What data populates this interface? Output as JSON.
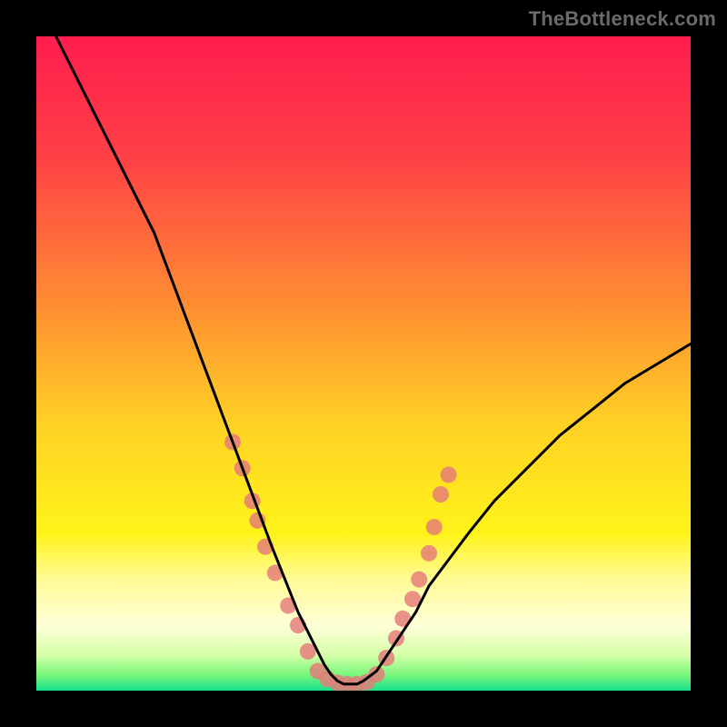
{
  "watermark": "TheBottleneck.com",
  "chart_data": {
    "type": "line",
    "title": "",
    "xlabel": "",
    "ylabel": "",
    "xlim": [
      0,
      100
    ],
    "ylim": [
      0,
      100
    ],
    "gradient_stops": [
      {
        "offset": 0.0,
        "color": "#ff1d4e"
      },
      {
        "offset": 0.18,
        "color": "#ff3f46"
      },
      {
        "offset": 0.4,
        "color": "#ff8a33"
      },
      {
        "offset": 0.6,
        "color": "#ffd324"
      },
      {
        "offset": 0.76,
        "color": "#fff31a"
      },
      {
        "offset": 0.83,
        "color": "#fffb96"
      },
      {
        "offset": 0.9,
        "color": "#ffffd8"
      },
      {
        "offset": 0.945,
        "color": "#d6ffa8"
      },
      {
        "offset": 0.975,
        "color": "#7cf87d"
      },
      {
        "offset": 1.0,
        "color": "#18e08b"
      }
    ],
    "series": [
      {
        "name": "bottleneck-curve",
        "color": "#000000",
        "stroke_width": 3,
        "x": [
          3,
          6,
          9,
          12,
          15,
          18,
          21,
          24,
          27,
          30,
          33,
          36,
          38,
          40,
          42,
          43,
          44,
          45,
          46,
          47,
          48,
          49,
          50,
          52,
          54,
          56,
          58,
          60,
          63,
          66,
          70,
          75,
          80,
          85,
          90,
          95,
          100
        ],
        "y": [
          100,
          94,
          88,
          82,
          76,
          70,
          62,
          54,
          46,
          38,
          30,
          22,
          17,
          12,
          8,
          6,
          4,
          2.5,
          1.5,
          1,
          1,
          1,
          1.5,
          3,
          6,
          9,
          12,
          16,
          20,
          24,
          29,
          34,
          39,
          43,
          47,
          50,
          53
        ]
      }
    ],
    "markers": {
      "name": "highlight-dots",
      "color": "#e47a7a",
      "opacity": 0.82,
      "radius": 9,
      "points": [
        {
          "x": 30.0,
          "y": 38
        },
        {
          "x": 31.5,
          "y": 34
        },
        {
          "x": 33.0,
          "y": 29
        },
        {
          "x": 33.8,
          "y": 26
        },
        {
          "x": 35.0,
          "y": 22
        },
        {
          "x": 36.5,
          "y": 18
        },
        {
          "x": 38.5,
          "y": 13
        },
        {
          "x": 40.0,
          "y": 10
        },
        {
          "x": 41.5,
          "y": 6
        },
        {
          "x": 43.0,
          "y": 3
        },
        {
          "x": 44.5,
          "y": 1.8
        },
        {
          "x": 46.0,
          "y": 1.2
        },
        {
          "x": 47.5,
          "y": 1
        },
        {
          "x": 49.0,
          "y": 1
        },
        {
          "x": 50.5,
          "y": 1.3
        },
        {
          "x": 52.0,
          "y": 2.5
        },
        {
          "x": 53.5,
          "y": 5
        },
        {
          "x": 55.0,
          "y": 8
        },
        {
          "x": 56.0,
          "y": 11
        },
        {
          "x": 57.5,
          "y": 14
        },
        {
          "x": 58.5,
          "y": 17
        },
        {
          "x": 60.0,
          "y": 21
        },
        {
          "x": 60.8,
          "y": 25
        },
        {
          "x": 61.8,
          "y": 30
        },
        {
          "x": 63.0,
          "y": 33
        }
      ]
    }
  }
}
